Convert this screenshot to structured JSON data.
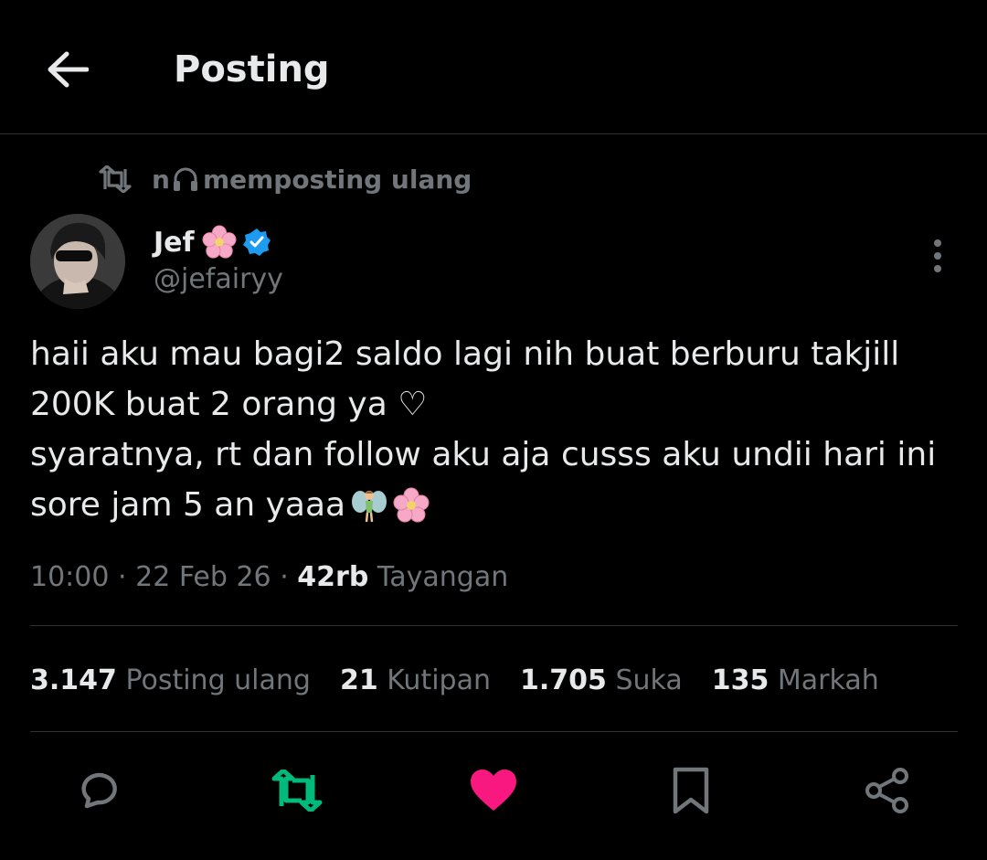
{
  "header": {
    "title": "Posting",
    "back_icon": "arrow-left-icon"
  },
  "repost": {
    "name": "n",
    "name_icon": "headphones-icon",
    "text": "memposting ulang",
    "icon": "repost-icon"
  },
  "author": {
    "name": "Jef",
    "handle": "@jefairyy",
    "badge": "verified-badge-icon",
    "name_emoji": "cherry-blossom-icon"
  },
  "post": {
    "lines": [
      "haii aku mau bagi2 saldo lagi nih buat berburu takjill",
      "200K buat 2 orang ya ♡",
      "syaratnya, rt dan follow aku aja cusss aku undii hari ini",
      "sore jam 5 an yaaa"
    ],
    "trailing_emojis": [
      "fairy-icon",
      "cherry-blossom-icon"
    ]
  },
  "meta": {
    "time": "10:00",
    "sep1": "·",
    "date": "22 Feb 26",
    "sep2": "·",
    "views_count": "42rb",
    "views_label": "Tayangan"
  },
  "stats": {
    "reposts_count": "3.147",
    "reposts_label": "Posting ulang",
    "quotes_count": "21",
    "quotes_label": "Kutipan",
    "likes_count": "1.705",
    "likes_label": "Suka",
    "bookmarks_count": "135",
    "bookmarks_label": "Markah"
  },
  "actions": [
    "reply-icon",
    "repost-icon",
    "like-icon",
    "bookmark-icon",
    "share-icon"
  ],
  "colors": {
    "background": "#000000",
    "text": "#e7e9ea",
    "muted": "#71767b",
    "repost_green": "#00ba7c",
    "like_pink": "#f91880",
    "verified_blue": "#1d9bf0",
    "divider": "#2f3336"
  }
}
